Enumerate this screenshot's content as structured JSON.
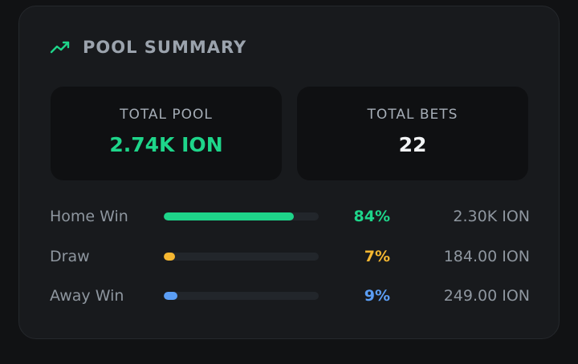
{
  "header": {
    "title": "POOL SUMMARY",
    "icon": "trending-up-icon",
    "icon_color": "#1ed58a"
  },
  "stats": {
    "total_pool": {
      "label": "TOTAL POOL",
      "value": "2.74K ION",
      "color": "#1ed58a"
    },
    "total_bets": {
      "label": "TOTAL BETS",
      "value": "22",
      "color": "#f2f4f6"
    }
  },
  "outcomes": [
    {
      "name": "Home Win",
      "percent_label": "84%",
      "percent": 84,
      "amount": "2.30K ION",
      "color": "#1ed58a"
    },
    {
      "name": "Draw",
      "percent_label": "7%",
      "percent": 7,
      "amount": "184.00 ION",
      "color": "#f5b731"
    },
    {
      "name": "Away Win",
      "percent_label": "9%",
      "percent": 9,
      "amount": "249.00 ION",
      "color": "#5b9ef5"
    }
  ]
}
